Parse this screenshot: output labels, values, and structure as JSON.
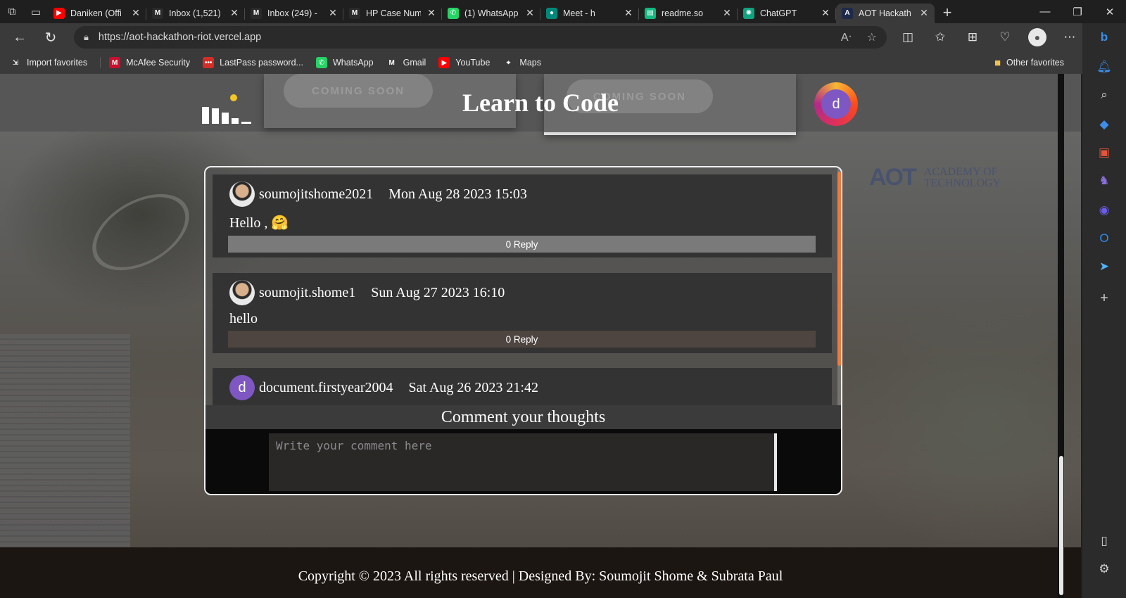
{
  "browser": {
    "tabs": [
      {
        "title": "Daniken (Offi",
        "icon": "youtube-icon",
        "color": "#ff0000",
        "glyph": "▶"
      },
      {
        "title": "Inbox (1,521)",
        "icon": "gmail-icon",
        "color": "#2a2a2a",
        "glyph": "M"
      },
      {
        "title": "Inbox (249) -",
        "icon": "gmail-icon",
        "color": "#2a2a2a",
        "glyph": "M"
      },
      {
        "title": "HP Case Num",
        "icon": "gmail-icon",
        "color": "#2a2a2a",
        "glyph": "M"
      },
      {
        "title": "(1) WhatsApp",
        "icon": "whatsapp-icon",
        "color": "#25d366",
        "glyph": "✆"
      },
      {
        "title": "Meet - h",
        "icon": "meet-icon",
        "color": "#00897b",
        "glyph": "●"
      },
      {
        "title": "readme.so",
        "icon": "readme-icon",
        "color": "#10b981",
        "glyph": "▤"
      },
      {
        "title": "ChatGPT",
        "icon": "chatgpt-icon",
        "color": "#10a37f",
        "glyph": "✺"
      },
      {
        "title": "AOT Hackath",
        "icon": "aot-icon",
        "color": "#1e2a4a",
        "glyph": "A"
      }
    ],
    "url": "https://aot-hackathon-riot.vercel.app",
    "favorites": [
      {
        "label": "Import favorites",
        "icon": "import-icon",
        "color": "#3a3a3a",
        "glyph": "⇲"
      },
      {
        "label": "McAfee Security",
        "icon": "mcafee-icon",
        "color": "#c8102e",
        "glyph": "M"
      },
      {
        "label": "LastPass password...",
        "icon": "lastpass-icon",
        "color": "#d32d27",
        "glyph": "•••"
      },
      {
        "label": "WhatsApp",
        "icon": "whatsapp-icon",
        "color": "#25d366",
        "glyph": "✆"
      },
      {
        "label": "Gmail",
        "icon": "gmail-icon",
        "color": "#3a3a3a",
        "glyph": "M"
      },
      {
        "label": "YouTube",
        "icon": "youtube-icon",
        "color": "#ff0000",
        "glyph": "▶"
      },
      {
        "label": "Maps",
        "icon": "maps-icon",
        "color": "#3a3a3a",
        "glyph": "⌖"
      }
    ],
    "other_favorites": "Other favorites"
  },
  "page": {
    "title": "Learn to Code",
    "coming_soon_1": "COMING SOON",
    "coming_soon_2": "COMING SOON",
    "avatar_letter": "d",
    "brand_mark": "AOT",
    "brand_line1": "ACADEMY OF",
    "brand_line2": "TECHNOLOGY"
  },
  "comments": [
    {
      "user": "soumojitshome2021",
      "date": "Mon Aug 28 2023 15:03",
      "text": "Hello , 🤗",
      "reply": "0 Reply",
      "avatar": "photo"
    },
    {
      "user": "soumojit.shome1",
      "date": "Sun Aug 27 2023 16:10",
      "text": "hello",
      "reply": "0 Reply",
      "avatar": "photo"
    },
    {
      "user": "document.firstyear2004",
      "date": "Sat Aug 26 2023 21:42",
      "avatar": "letter",
      "avatar_letter": "d"
    }
  ],
  "comment_form": {
    "heading": "Comment your thoughts",
    "placeholder": "Write your comment here"
  },
  "footer": {
    "text": "Copyright © 2023 All rights reserved | Designed By: Soumojit Shome & Subrata Paul"
  },
  "colors": {
    "scroll_accent": "#f07a3c",
    "avatar_purple": "#7e57c2",
    "reply_bar_1": "#7a7a7a",
    "reply_bar_2": "#4e4540"
  }
}
